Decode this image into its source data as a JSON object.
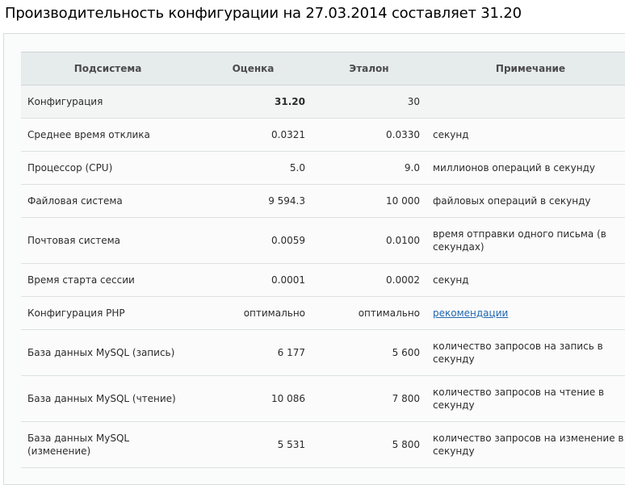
{
  "title": "Производительность конфигурации на 27.03.2014 составляет 31.20",
  "table": {
    "headers": {
      "subsystem": "Подсистема",
      "score": "Оценка",
      "reference": "Эталон",
      "note": "Примечание"
    },
    "rows": [
      {
        "name": "Конфигурация",
        "score": "31.20",
        "reference": "30",
        "note": ""
      },
      {
        "name": "Среднее время отклика",
        "score": "0.0321",
        "reference": "0.0330",
        "note": "секунд"
      },
      {
        "name": "Процессор (CPU)",
        "score": "5.0",
        "reference": "9.0",
        "note": "миллионов операций в секунду"
      },
      {
        "name": "Файловая система",
        "score": "9 594.3",
        "reference": "10 000",
        "note": "файловых операций в секунду"
      },
      {
        "name": "Почтовая система",
        "score": "0.0059",
        "reference": "0.0100",
        "note": "время отправки одного письма (в секундах)"
      },
      {
        "name": "Время старта сессии",
        "score": "0.0001",
        "reference": "0.0002",
        "note": "секунд"
      },
      {
        "name": "Конфигурация PHP",
        "score": "оптимально",
        "reference": "оптимально",
        "note": "рекомендации"
      },
      {
        "name": "База данных MySQL (запись)",
        "score": "6 177",
        "reference": "5 600",
        "note": "количество запросов на запись в секунду"
      },
      {
        "name": "База данных MySQL (чтение)",
        "score": "10 086",
        "reference": "7 800",
        "note": "количество запросов на чтение в секунду"
      },
      {
        "name": "База данных MySQL (изменение)",
        "score": "5 531",
        "reference": "5 800",
        "note": "количество запросов на изменение в секунду"
      }
    ]
  }
}
